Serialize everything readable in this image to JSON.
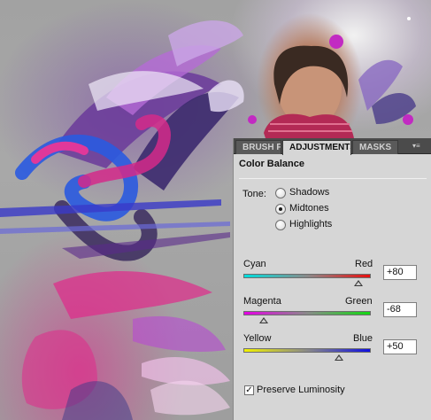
{
  "panel": {
    "tabs": [
      {
        "label": "BRUSH P"
      },
      {
        "label": "ADJUSTMENTS"
      },
      {
        "label": "MASKS"
      }
    ],
    "menu_icon": "panel-menu-icon",
    "title": "Color Balance",
    "tone": {
      "label": "Tone:",
      "options": [
        {
          "label": "Shadows",
          "selected": false
        },
        {
          "label": "Midtones",
          "selected": true
        },
        {
          "label": "Highlights",
          "selected": false
        }
      ]
    },
    "sliders": [
      {
        "left": "Cyan",
        "right": "Red",
        "value": "+80",
        "amount": 80,
        "colors": [
          "#00dede",
          "#e81010"
        ]
      },
      {
        "left": "Magenta",
        "right": "Green",
        "value": "-68",
        "amount": -68,
        "colors": [
          "#e400e4",
          "#12d812"
        ]
      },
      {
        "left": "Yellow",
        "right": "Blue",
        "value": "+50",
        "amount": 50,
        "colors": [
          "#f2f200",
          "#1010e0"
        ]
      }
    ],
    "preserve": {
      "label": "Preserve Luminosity",
      "checked": true
    }
  }
}
